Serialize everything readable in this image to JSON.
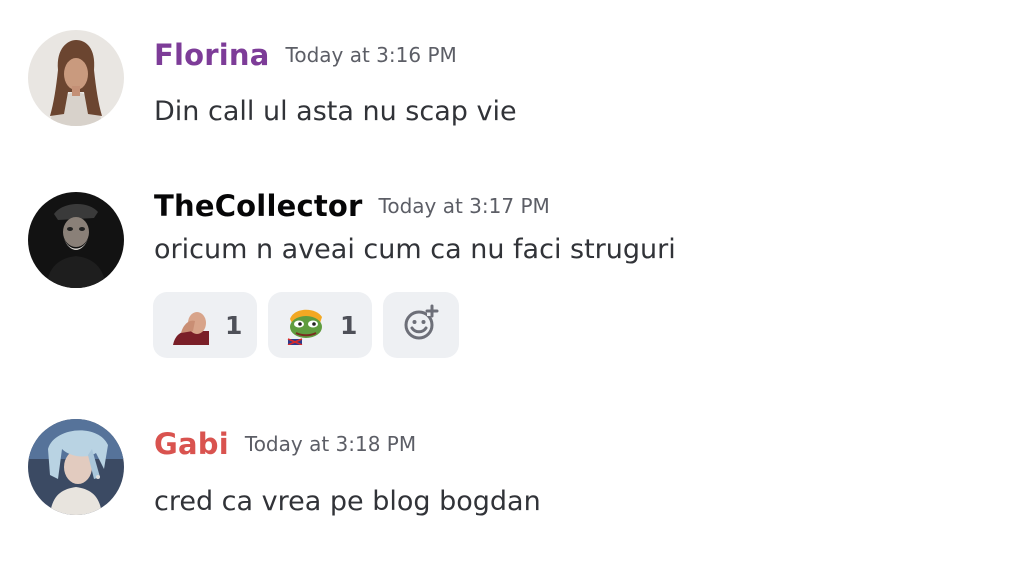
{
  "messages": [
    {
      "username": "Florina",
      "username_color": "#7d3c98",
      "timestamp": "Today at 3:16 PM",
      "text": "Din call ul asta nu scap vie",
      "avatar": "avatar-florina"
    },
    {
      "username": "TheCollector",
      "username_color": "#060607",
      "timestamp": "Today at 3:17 PM",
      "text": "oricum n aveai cum ca nu faci struguri",
      "avatar": "avatar-thecollector",
      "reactions": [
        {
          "emoji": "facepalm-emoji",
          "count": "1"
        },
        {
          "emoji": "pepe-frog-emoji",
          "count": "1"
        }
      ],
      "add_reaction_icon": "add-reaction-icon"
    },
    {
      "username": "Gabi",
      "username_color": "#d9534f",
      "timestamp": "Today at 3:18 PM",
      "text": "cred ca vrea pe blog bogdan",
      "avatar": "avatar-gabi"
    }
  ]
}
